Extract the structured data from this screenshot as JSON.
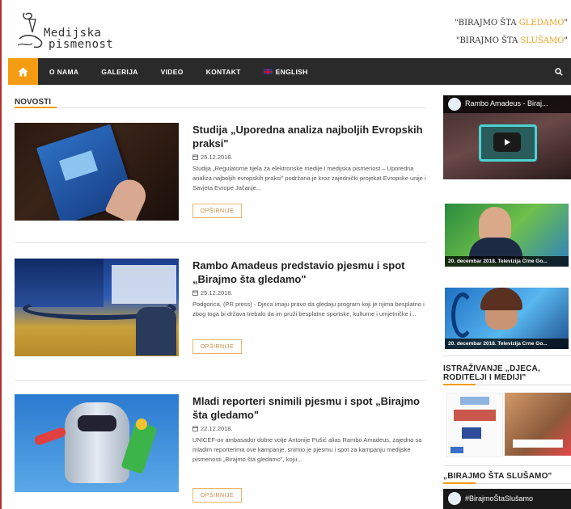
{
  "header": {
    "logo_line1": "Medijska",
    "logo_line2": "pismenost",
    "slogan1_prefix": "\"BIRAJMO ŠTA ",
    "slogan1_accent": "GLEDAMO",
    "slogan1_suffix": "\"",
    "slogan2_prefix": "\"BIRAJMO ŠTA ",
    "slogan2_accent": "SLUŠAMO",
    "slogan2_suffix": "\""
  },
  "nav": {
    "items": [
      "O NAMA",
      "GALERIJA",
      "VIDEO",
      "KONTAKT",
      "ENGLISH"
    ],
    "accent": "#f39c12",
    "background": "#2a2a2a"
  },
  "main": {
    "section_title": "NOVOSTI",
    "more_label": "OPŠIRNIJE",
    "articles": [
      {
        "title": "Studija „Uporedna analiza najboljih Evropskih praksi\"",
        "date": "25.12.2018.",
        "excerpt": "Studija „Regulatorne tijela za elektronske medije i medijska pismenost – Uporedna analiza najboljih evropskih praksi\" podržana je kroz zajednički projekat Evropske unije i Savjeta Evrope Jačanje..."
      },
      {
        "title": "Rambo Amadeus predstavio pjesmu i spot „Birajmo šta gledamo\"",
        "date": "25.12.2018.",
        "excerpt": "Podgorica, (PR press) - Djeca imaju pravo da gledaju program koji je njima besplatno i zbog toga bi država trebalo da im pruži besplatne sportske, kulturne i umjetničke i..."
      },
      {
        "title": "Mladi reporteri snimili pjesmu i spot „Birajmo šta gledamo\"",
        "date": "22.12.2018.",
        "excerpt": "UNICEF-ov ambasador dobre volje Antonije Pušić alias Rambo Amadeus, zajedno sa mladim reporterima ove kampanje, snimio je pjesmu i spot za kampanju medijske pismenosti „Birajmo šta gledamo\", koju..."
      }
    ]
  },
  "sidebar": {
    "video1_title": "Rambo Amadeus - Biraj...",
    "video2_caption": "20. decembar 2018. Televizija Crne Go...",
    "video3_caption": "20. decembar 2018. Televizija Crne Go...",
    "research_title_l1": "ISTRAŽIVANJE „DJECA,",
    "research_title_l2": "RODITELJI I MEDIJI\"",
    "listen_title": "„BIRAJMO ŠTA SLUŠAMO\"",
    "video4_title": "#BirajmoŠtaSlušamo"
  }
}
